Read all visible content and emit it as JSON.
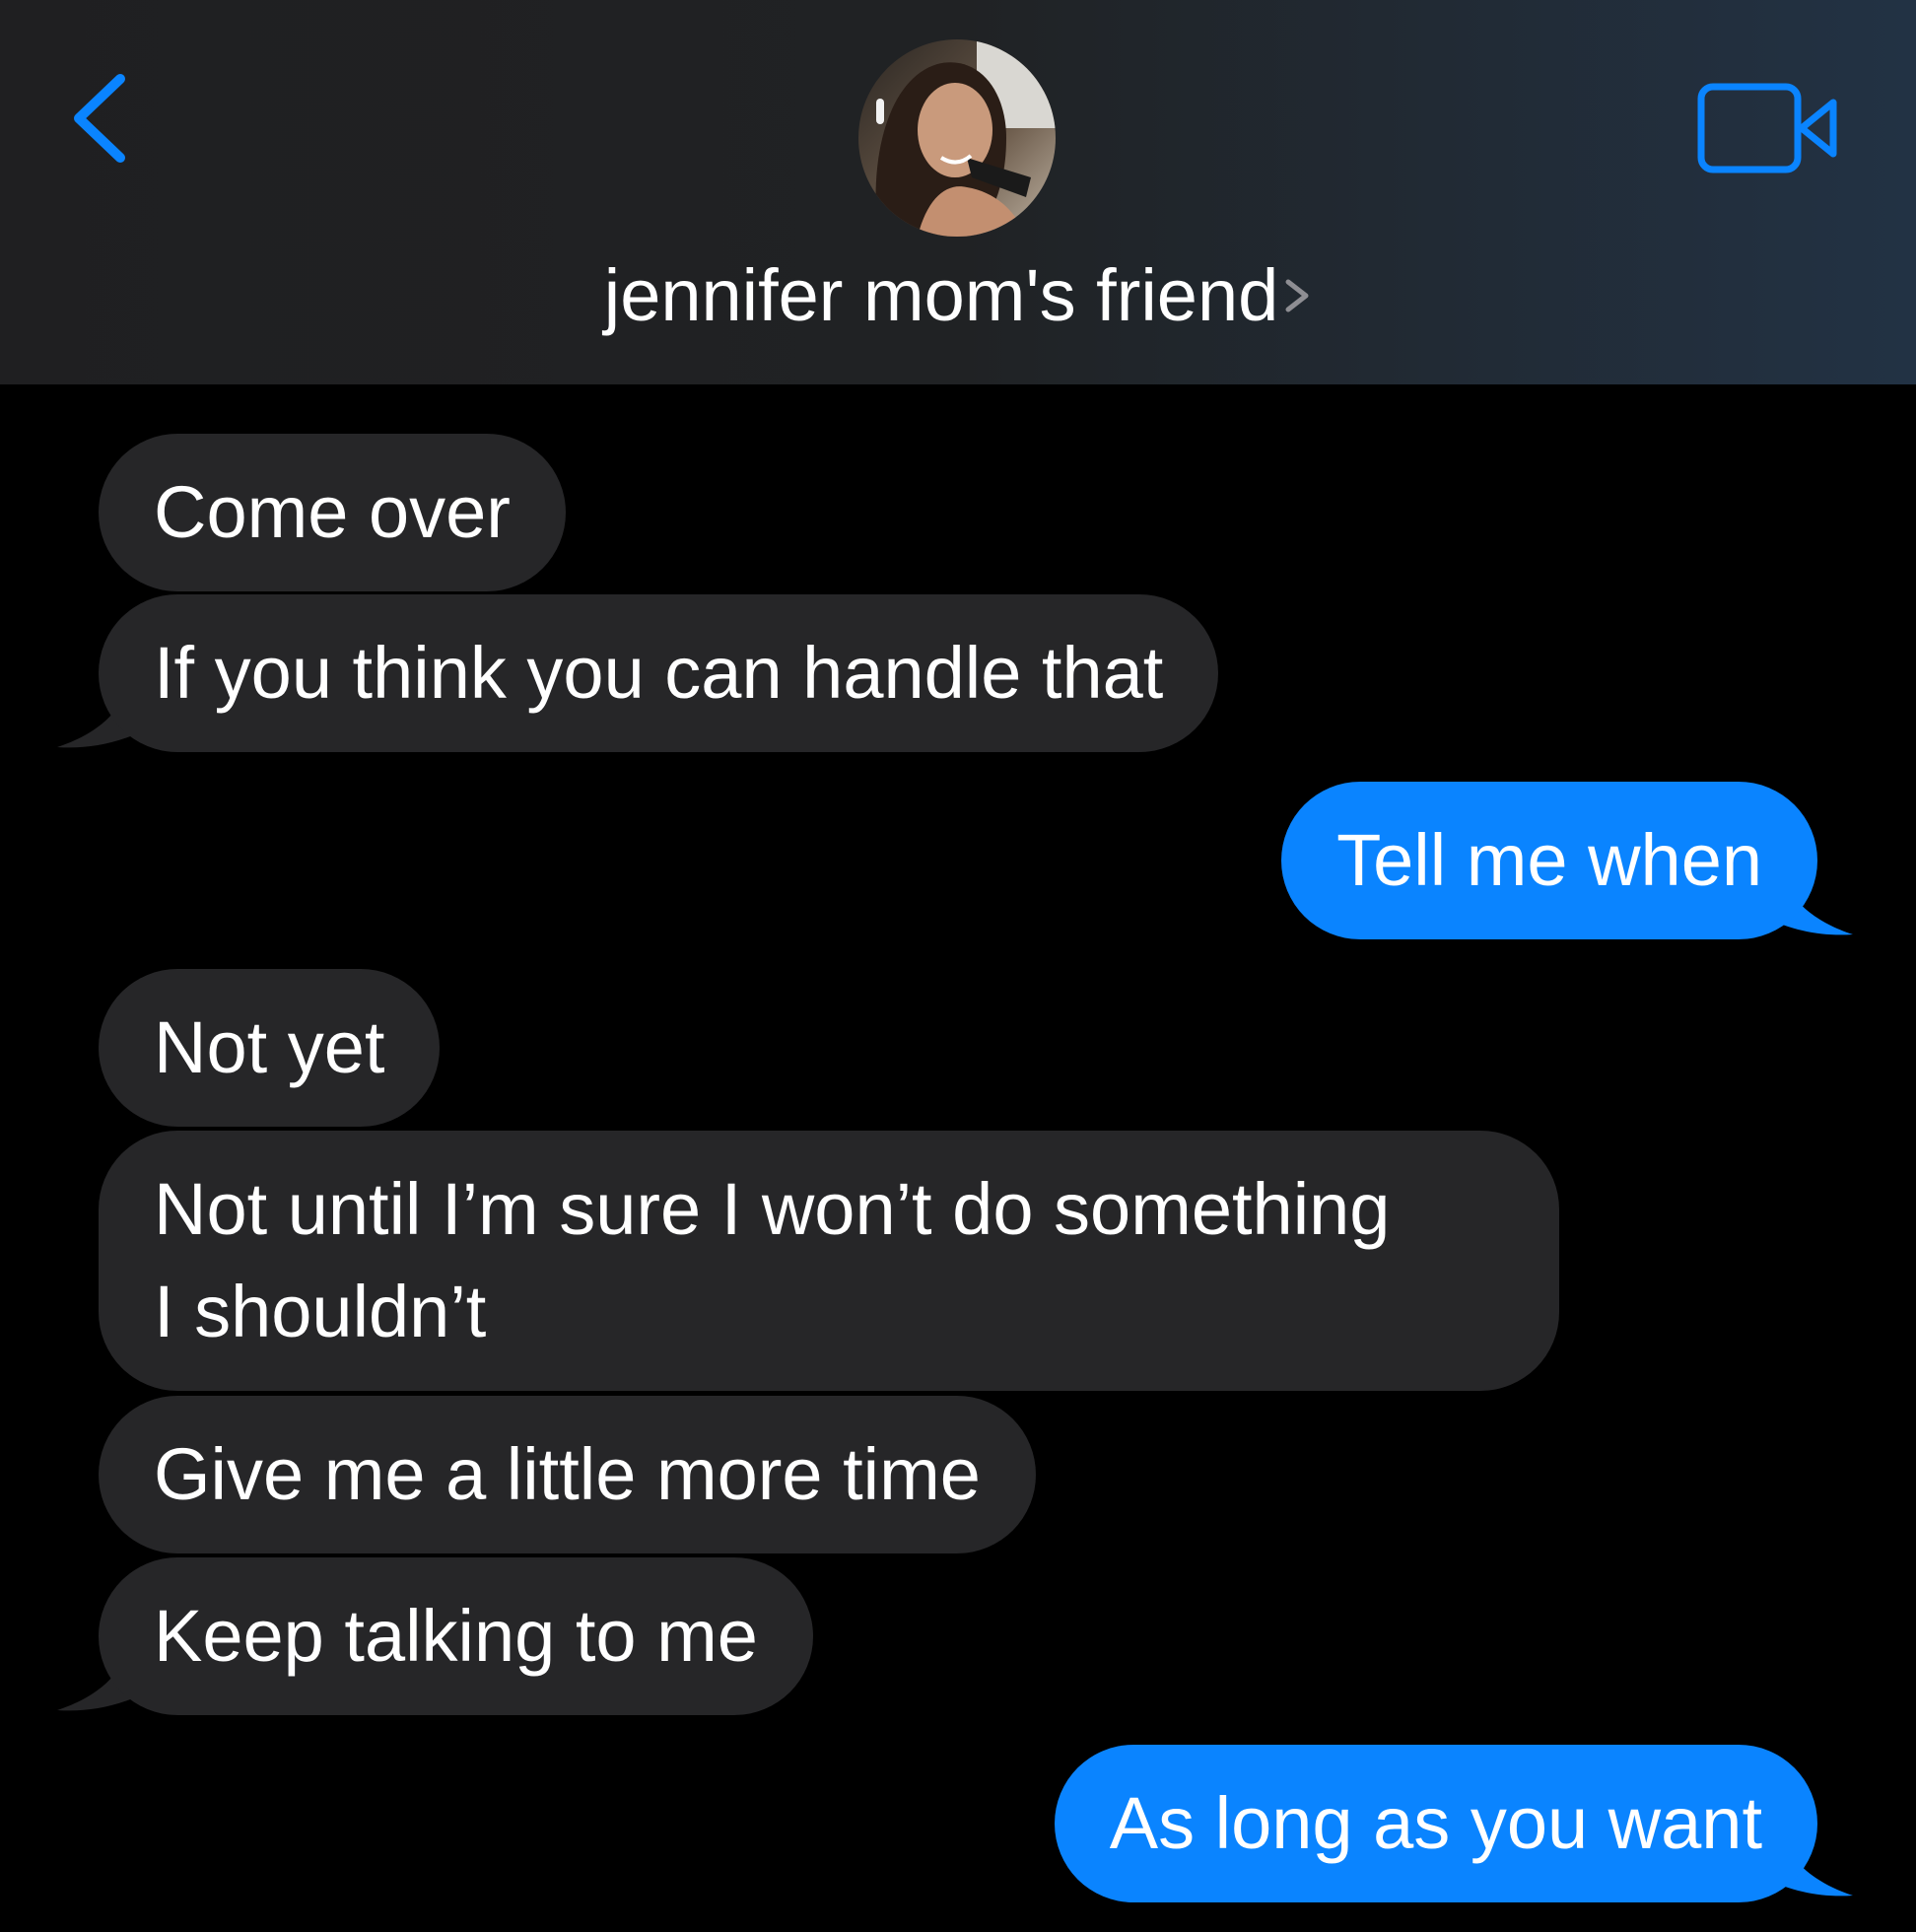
{
  "header": {
    "back_icon": "chevron-left-icon",
    "contact_name": "jennifer mom's friend",
    "video_icon": "video-camera-icon",
    "accent_color": "#0a84ff"
  },
  "messages": [
    {
      "direction": "incoming",
      "text": "Come over"
    },
    {
      "direction": "incoming",
      "text": "If you think you can handle that"
    },
    {
      "direction": "outgoing",
      "text": "Tell me when"
    },
    {
      "direction": "incoming",
      "text": "Not yet"
    },
    {
      "direction": "incoming",
      "line1": "Not until I’m sure I won’t do something",
      "line2": "I shouldn’t"
    },
    {
      "direction": "incoming",
      "text": "Give me a little more time"
    },
    {
      "direction": "incoming",
      "text": "Keep talking to me"
    },
    {
      "direction": "outgoing",
      "text": "As long as you want"
    }
  ],
  "colors": {
    "incoming_bubble": "#262628",
    "outgoing_bubble": "#0a84ff",
    "background": "#000000"
  }
}
